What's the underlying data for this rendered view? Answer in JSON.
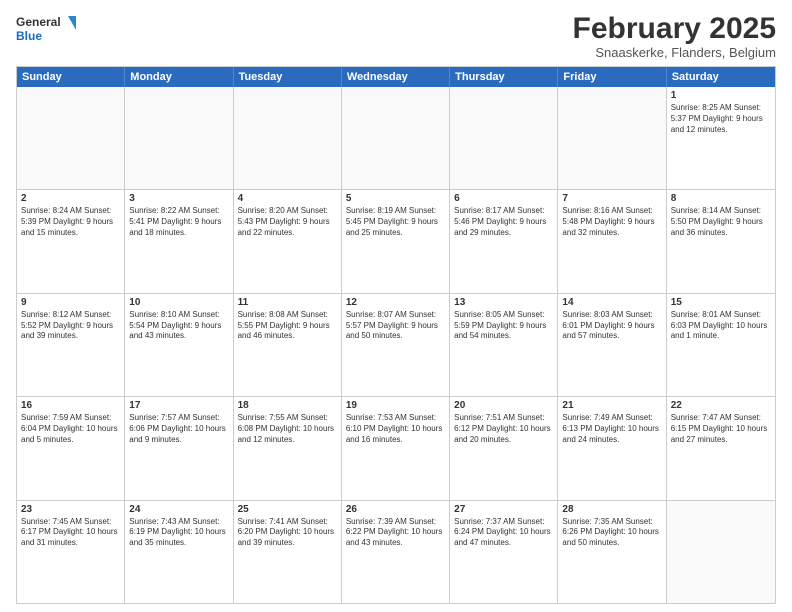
{
  "header": {
    "logo_line1": "General",
    "logo_line2": "Blue",
    "month": "February 2025",
    "location": "Snaaskerke, Flanders, Belgium"
  },
  "weekdays": [
    "Sunday",
    "Monday",
    "Tuesday",
    "Wednesday",
    "Thursday",
    "Friday",
    "Saturday"
  ],
  "rows": [
    [
      {
        "day": "",
        "text": ""
      },
      {
        "day": "",
        "text": ""
      },
      {
        "day": "",
        "text": ""
      },
      {
        "day": "",
        "text": ""
      },
      {
        "day": "",
        "text": ""
      },
      {
        "day": "",
        "text": ""
      },
      {
        "day": "1",
        "text": "Sunrise: 8:25 AM\nSunset: 5:37 PM\nDaylight: 9 hours and 12 minutes."
      }
    ],
    [
      {
        "day": "2",
        "text": "Sunrise: 8:24 AM\nSunset: 5:39 PM\nDaylight: 9 hours and 15 minutes."
      },
      {
        "day": "3",
        "text": "Sunrise: 8:22 AM\nSunset: 5:41 PM\nDaylight: 9 hours and 18 minutes."
      },
      {
        "day": "4",
        "text": "Sunrise: 8:20 AM\nSunset: 5:43 PM\nDaylight: 9 hours and 22 minutes."
      },
      {
        "day": "5",
        "text": "Sunrise: 8:19 AM\nSunset: 5:45 PM\nDaylight: 9 hours and 25 minutes."
      },
      {
        "day": "6",
        "text": "Sunrise: 8:17 AM\nSunset: 5:46 PM\nDaylight: 9 hours and 29 minutes."
      },
      {
        "day": "7",
        "text": "Sunrise: 8:16 AM\nSunset: 5:48 PM\nDaylight: 9 hours and 32 minutes."
      },
      {
        "day": "8",
        "text": "Sunrise: 8:14 AM\nSunset: 5:50 PM\nDaylight: 9 hours and 36 minutes."
      }
    ],
    [
      {
        "day": "9",
        "text": "Sunrise: 8:12 AM\nSunset: 5:52 PM\nDaylight: 9 hours and 39 minutes."
      },
      {
        "day": "10",
        "text": "Sunrise: 8:10 AM\nSunset: 5:54 PM\nDaylight: 9 hours and 43 minutes."
      },
      {
        "day": "11",
        "text": "Sunrise: 8:08 AM\nSunset: 5:55 PM\nDaylight: 9 hours and 46 minutes."
      },
      {
        "day": "12",
        "text": "Sunrise: 8:07 AM\nSunset: 5:57 PM\nDaylight: 9 hours and 50 minutes."
      },
      {
        "day": "13",
        "text": "Sunrise: 8:05 AM\nSunset: 5:59 PM\nDaylight: 9 hours and 54 minutes."
      },
      {
        "day": "14",
        "text": "Sunrise: 8:03 AM\nSunset: 6:01 PM\nDaylight: 9 hours and 57 minutes."
      },
      {
        "day": "15",
        "text": "Sunrise: 8:01 AM\nSunset: 6:03 PM\nDaylight: 10 hours and 1 minute."
      }
    ],
    [
      {
        "day": "16",
        "text": "Sunrise: 7:59 AM\nSunset: 6:04 PM\nDaylight: 10 hours and 5 minutes."
      },
      {
        "day": "17",
        "text": "Sunrise: 7:57 AM\nSunset: 6:06 PM\nDaylight: 10 hours and 9 minutes."
      },
      {
        "day": "18",
        "text": "Sunrise: 7:55 AM\nSunset: 6:08 PM\nDaylight: 10 hours and 12 minutes."
      },
      {
        "day": "19",
        "text": "Sunrise: 7:53 AM\nSunset: 6:10 PM\nDaylight: 10 hours and 16 minutes."
      },
      {
        "day": "20",
        "text": "Sunrise: 7:51 AM\nSunset: 6:12 PM\nDaylight: 10 hours and 20 minutes."
      },
      {
        "day": "21",
        "text": "Sunrise: 7:49 AM\nSunset: 6:13 PM\nDaylight: 10 hours and 24 minutes."
      },
      {
        "day": "22",
        "text": "Sunrise: 7:47 AM\nSunset: 6:15 PM\nDaylight: 10 hours and 27 minutes."
      }
    ],
    [
      {
        "day": "23",
        "text": "Sunrise: 7:45 AM\nSunset: 6:17 PM\nDaylight: 10 hours and 31 minutes."
      },
      {
        "day": "24",
        "text": "Sunrise: 7:43 AM\nSunset: 6:19 PM\nDaylight: 10 hours and 35 minutes."
      },
      {
        "day": "25",
        "text": "Sunrise: 7:41 AM\nSunset: 6:20 PM\nDaylight: 10 hours and 39 minutes."
      },
      {
        "day": "26",
        "text": "Sunrise: 7:39 AM\nSunset: 6:22 PM\nDaylight: 10 hours and 43 minutes."
      },
      {
        "day": "27",
        "text": "Sunrise: 7:37 AM\nSunset: 6:24 PM\nDaylight: 10 hours and 47 minutes."
      },
      {
        "day": "28",
        "text": "Sunrise: 7:35 AM\nSunset: 6:26 PM\nDaylight: 10 hours and 50 minutes."
      },
      {
        "day": "",
        "text": ""
      }
    ]
  ]
}
